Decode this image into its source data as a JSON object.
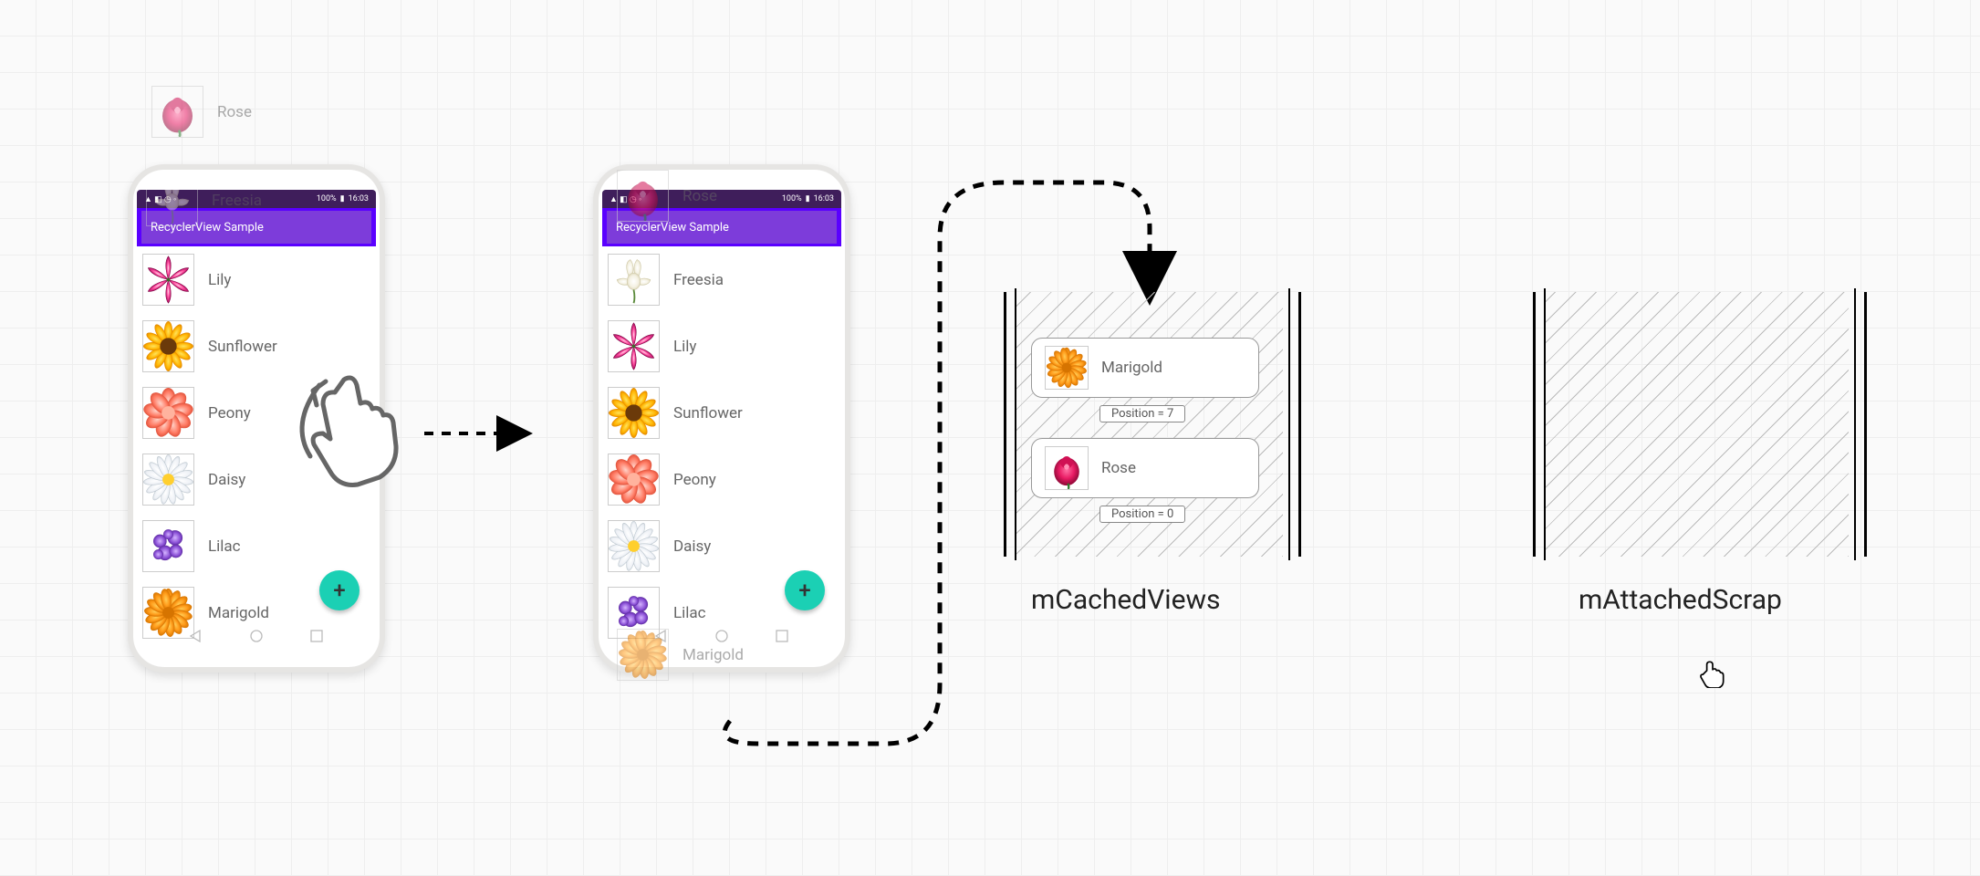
{
  "phone": {
    "status": {
      "battery": "100%",
      "time": "16:03"
    },
    "appbar": "RecyclerView Sample",
    "fab_glyph": "+"
  },
  "left_list": [
    "Lily",
    "Sunflower",
    "Peony",
    "Daisy",
    "Lilac",
    "Marigold"
  ],
  "right_list": [
    "Freesia",
    "Lily",
    "Sunflower",
    "Peony",
    "Daisy",
    "Lilac"
  ],
  "ghost_left": {
    "top": "Rose",
    "under_appbar": "Freesia"
  },
  "ghost_right": {
    "top": "Rose",
    "bottom": "Marigold"
  },
  "cache": {
    "title_left": "mCachedViews",
    "title_right": "mAttachedScrap",
    "cards": [
      {
        "label": "Marigold",
        "pos": "Position = 7"
      },
      {
        "label": "Rose",
        "pos": "Position = 0"
      }
    ]
  },
  "icons": {
    "rose": "rose",
    "freesia": "freesia",
    "lily": "lily",
    "sunflower": "sunflower",
    "peony": "peony",
    "daisy": "daisy",
    "lilac": "lilac",
    "marigold": "marigold"
  }
}
